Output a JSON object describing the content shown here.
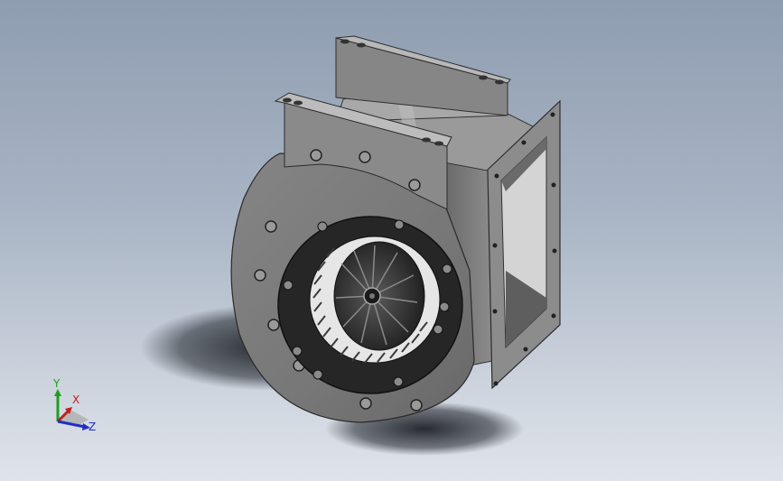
{
  "viewport": {
    "background_top": "#8f9db1",
    "background_bottom": "#dfe3ea"
  },
  "model": {
    "name": "centrifugal-blower-fan",
    "body_color": "#7a7a7a",
    "dark_color": "#2a2a2a",
    "bolt_color": "#8a8a8a"
  },
  "triad": {
    "y_label": "Y",
    "x_label": "X",
    "z_label": "Z",
    "y_color": "#1aa01a",
    "x_color": "#c02020",
    "z_color": "#2030c0"
  }
}
